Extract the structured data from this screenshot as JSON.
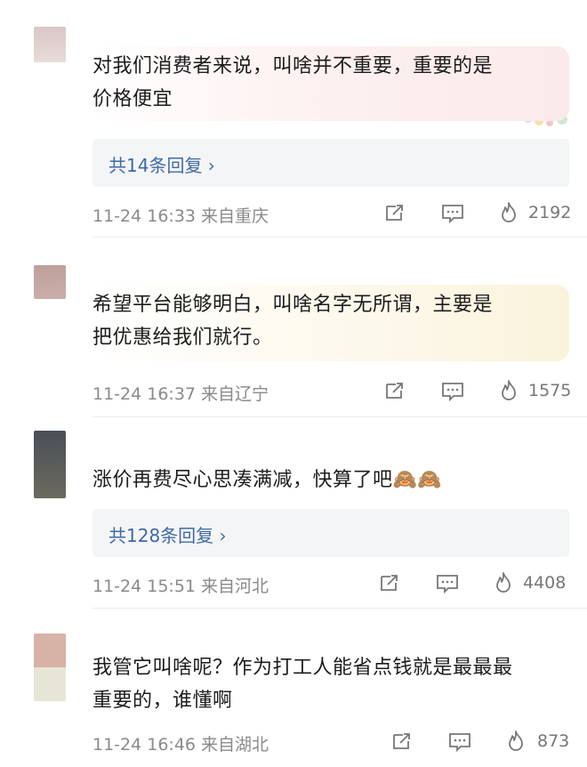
{
  "comments": [
    {
      "text": "对我们消费者来说，叫啥并不重要，重要的是\n价格便宜",
      "replies_label": "共14条回复 ›",
      "meta": "11-24 16:33 来自重庆",
      "likes": "2192",
      "avatar_colors": [
        "#d9c7c5",
        "#e8dcd8"
      ],
      "bubble_color": "#fbeeee"
    },
    {
      "text": "希望平台能够明白，叫啥名字无所谓，主要是\n把优惠给我们就行。",
      "meta": "11-24 16:37 来自辽宁",
      "likes": "1575",
      "avatar_colors": [
        "#bfa09c",
        "#c9aeaa"
      ],
      "bubble_color": "#fbf6e8"
    },
    {
      "text": "涨价再费尽心思凑满减，快算了吧🙈🙈",
      "replies_label": "共128条回复 ›",
      "meta": "11-24 15:51 来自河北",
      "likes": "4408",
      "avatar_colors": [
        "#4a4f57",
        "#6b6a5e"
      ]
    },
    {
      "text": "我管它叫啥呢？作为打工人能省点钱就是最最最\n重要的，谁懂啊",
      "meta": "11-24 16:46 来自湖北",
      "likes": "873",
      "avatar_colors": [
        "#d7b2a6",
        "#e7e6d6"
      ]
    }
  ],
  "icons": {
    "share": "share-icon",
    "comment": "comment-icon",
    "like": "flame-like-icon"
  }
}
